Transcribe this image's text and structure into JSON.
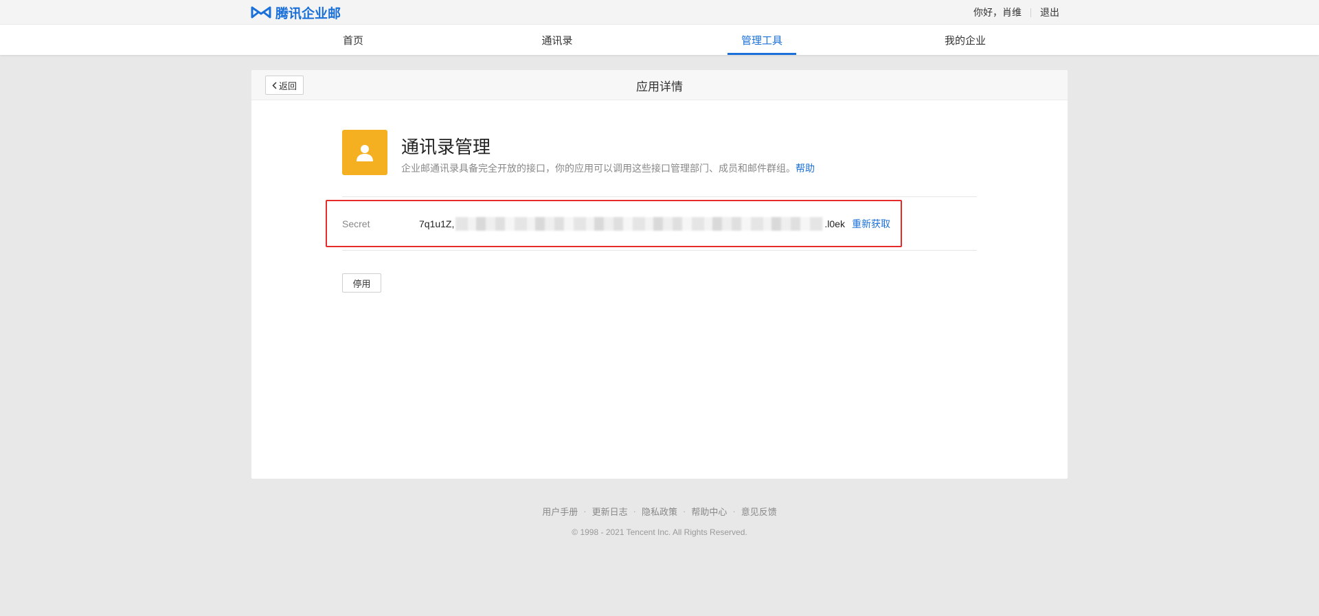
{
  "brand": {
    "name": "腾讯企业邮",
    "color": "#1a70d8"
  },
  "user": {
    "greeting": "你好，肖维",
    "logout_label": "退出"
  },
  "nav": {
    "items": [
      {
        "label": "首页"
      },
      {
        "label": "通讯录"
      },
      {
        "label": "管理工具",
        "active": true
      },
      {
        "label": "我的企业"
      }
    ]
  },
  "page": {
    "back_label": "返回",
    "title": "应用详情"
  },
  "app": {
    "icon": "user-silhouette-icon",
    "icon_color": "#f5b021",
    "name": "通讯录管理",
    "description": "企业邮通讯录具备完全开放的接口，你的应用可以调用这些接口管理部门、成员和邮件群组。",
    "help_label": "帮助"
  },
  "secret": {
    "label": "Secret",
    "value_prefix": "7q1u1Z,",
    "value_suffix": ".l0ek",
    "refresh_label": "重新获取",
    "highlight_color": "#e52a2a"
  },
  "actions": {
    "disable_label": "停用"
  },
  "footer": {
    "links": [
      "用户手册",
      "更新日志",
      "隐私政策",
      "帮助中心",
      "意见反馈"
    ],
    "copyright": "© 1998 - 2021 Tencent Inc. All Rights Reserved."
  }
}
